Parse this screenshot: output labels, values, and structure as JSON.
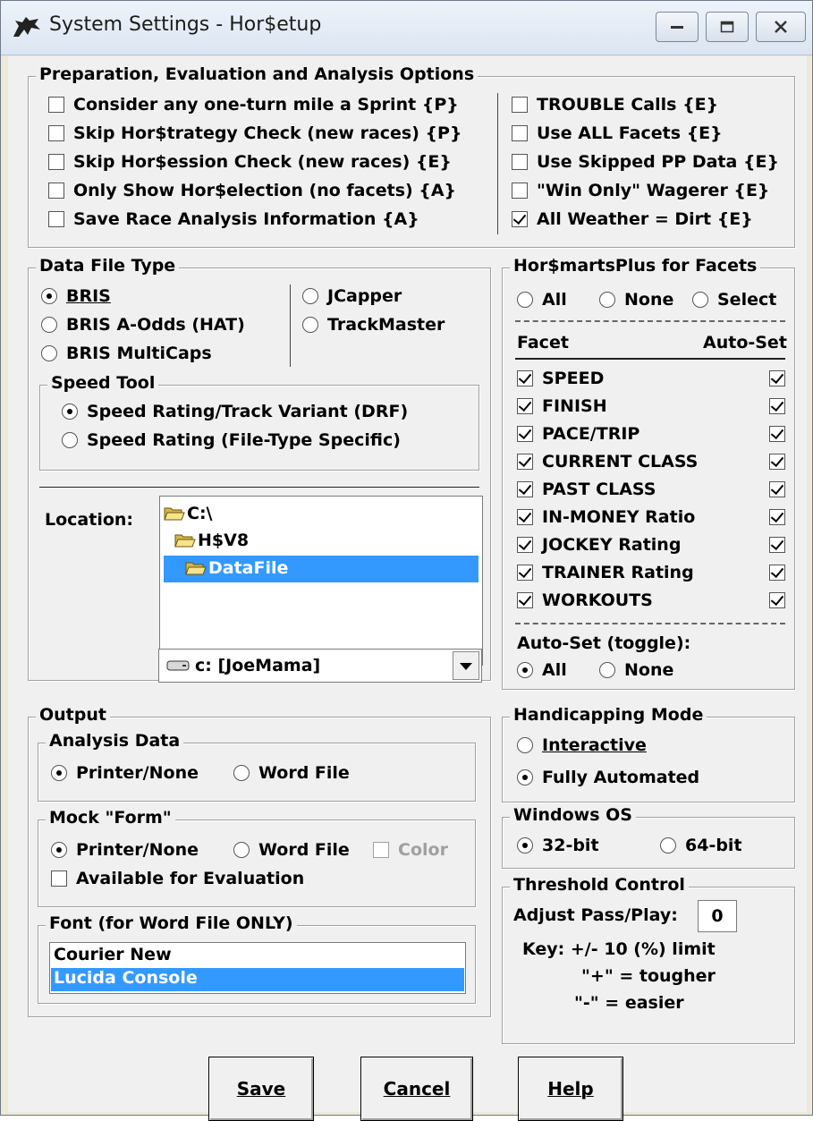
{
  "window": {
    "title": "System Settings - Hor$etup"
  },
  "prep": {
    "legend": "Preparation, Evaluation and Analysis Options",
    "left": [
      {
        "label": "Consider any one-turn mile a Sprint {P}",
        "checked": false
      },
      {
        "label": "Skip Hor$trategy Check (new races) {P}",
        "checked": false
      },
      {
        "label": "Skip Hor$ession Check (new races) {E}",
        "checked": false
      },
      {
        "label": "Only Show Hor$election (no facets) {A}",
        "checked": false
      },
      {
        "label": "Save Race Analysis Information {A}",
        "checked": false
      }
    ],
    "right": [
      {
        "label": "TROUBLE Calls {E}",
        "checked": false
      },
      {
        "label": "Use ALL Facets {E}",
        "checked": false
      },
      {
        "label": "Use Skipped PP Data {E}",
        "checked": false
      },
      {
        "label": "\"Win Only\" Wagerer {E}",
        "checked": false
      },
      {
        "label": "All Weather = Dirt {E}",
        "checked": true
      }
    ]
  },
  "datafile": {
    "legend": "Data File Type",
    "options": [
      "BRIS",
      "BRIS A-Odds (HAT)",
      "BRIS MultiCaps",
      "JCapper",
      "TrackMaster"
    ],
    "selected": "BRIS",
    "speed_tool": {
      "legend": "Speed Tool",
      "options": [
        "Speed Rating/Track Variant (DRF)",
        "Speed Rating (File-Type Specific)"
      ],
      "selected": "Speed Rating/Track Variant (DRF)"
    },
    "location_label": "Location:",
    "folders": [
      "C:\\",
      "H$V8",
      "DataFile"
    ],
    "selected_folder": "DataFile",
    "drive": "c: [JoeMama]"
  },
  "smarts": {
    "legend": "Hor$martsPlus for Facets",
    "options": [
      "All",
      "None",
      "Select"
    ],
    "facet_header": "Facet",
    "autoset_header": "Auto-Set",
    "facets": [
      "SPEED",
      "FINISH",
      "PACE/TRIP",
      "CURRENT CLASS",
      "PAST CLASS",
      "IN-MONEY Ratio",
      "JOCKEY Rating",
      "TRAINER Rating",
      "WORKOUTS"
    ],
    "autoset_label": "Auto-Set (toggle):",
    "autoset_options": [
      "All",
      "None"
    ],
    "autoset_selected": "All"
  },
  "output": {
    "legend": "Output",
    "analysis": {
      "legend": "Analysis Data",
      "options": [
        "Printer/None",
        "Word File"
      ],
      "selected": "Printer/None"
    },
    "mock": {
      "legend": "Mock \"Form\"",
      "options": [
        "Printer/None",
        "Word File"
      ],
      "selected": "Printer/None",
      "color_label": "Color",
      "available_label": "Available for Evaluation"
    },
    "font": {
      "legend": "Font (for Word File ONLY)",
      "items": [
        "Courier New",
        "Lucida Console"
      ],
      "selected": "Lucida Console"
    }
  },
  "mode": {
    "legend": "Handicapping Mode",
    "options": [
      "Interactive",
      "Fully Automated"
    ],
    "selected": "Fully Automated"
  },
  "os": {
    "legend": "Windows OS",
    "options": [
      "32-bit",
      "64-bit"
    ],
    "selected": "32-bit"
  },
  "threshold": {
    "legend": "Threshold Control",
    "adjust_label": "Adjust Pass/Play:",
    "adjust_value": "0",
    "key_line": "Key: +/- 10 (%) limit",
    "tougher": "\"+\" = tougher",
    "easier": "\"-\" = easier"
  },
  "buttons": {
    "save": "Save",
    "cancel": "Cancel",
    "help": "Help"
  }
}
